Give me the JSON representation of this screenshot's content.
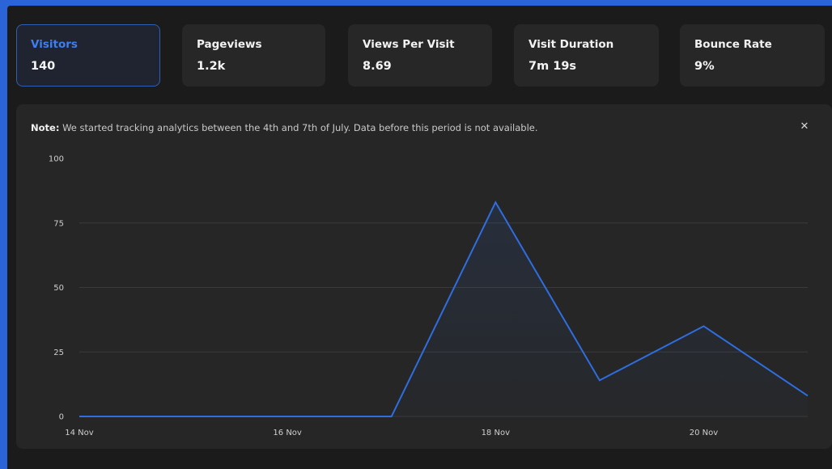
{
  "stats": [
    {
      "label": "Visitors",
      "value": "140",
      "active": true
    },
    {
      "label": "Pageviews",
      "value": "1.2k",
      "active": false
    },
    {
      "label": "Views Per Visit",
      "value": "8.69",
      "active": false
    },
    {
      "label": "Visit Duration",
      "value": "7m 19s",
      "active": false
    },
    {
      "label": "Bounce Rate",
      "value": "9%",
      "active": false
    }
  ],
  "note": {
    "prefix": "Note:",
    "text": "We started tracking analytics between the 4th and 7th of July. Data before this period is not available."
  },
  "close_icon": "close-icon",
  "colors": {
    "accent": "#2f6ee0",
    "background": "#1b1b1b",
    "panel": "#262626",
    "card": "#272727"
  },
  "chart_data": {
    "type": "area",
    "x": [
      "14 Nov",
      "15 Nov",
      "16 Nov",
      "17 Nov",
      "18 Nov",
      "19 Nov",
      "20 Nov",
      "21 Nov"
    ],
    "x_tick_labels": [
      "14 Nov",
      "16 Nov",
      "18 Nov",
      "20 Nov"
    ],
    "series": [
      {
        "values": [
          0,
          0,
          0,
          0,
          83,
          14,
          35,
          8
        ]
      }
    ],
    "y_ticks": [
      0,
      25,
      50,
      75,
      100
    ],
    "ylim": [
      0,
      100
    ],
    "grid": true,
    "legend": "none"
  }
}
